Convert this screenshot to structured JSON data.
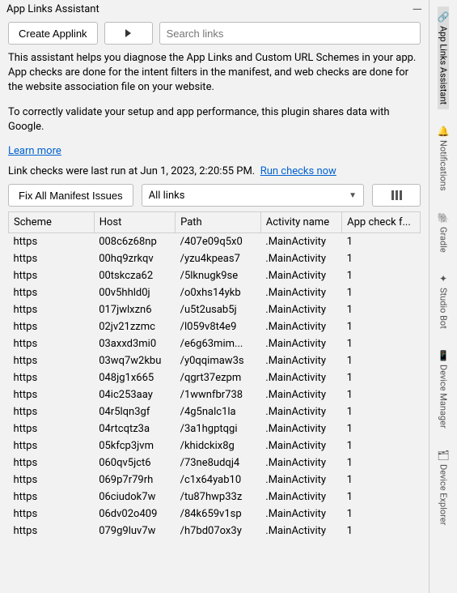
{
  "panel": {
    "title": "App Links Assistant"
  },
  "toolbar": {
    "create_label": "Create Applink"
  },
  "search": {
    "placeholder": "Search links"
  },
  "intro": {
    "p1": "This assistant helps you diagnose the App Links and Custom URL Schemes in your app. App checks are done for the intent filters in the manifest, and web checks are done for the website association file on your website.",
    "p2": "To correctly validate your setup and app performance, this plugin shares data with Google.",
    "learn_more": "Learn more"
  },
  "status": {
    "last_run_prefix": "Link checks were last run at ",
    "last_run_time": "Jun 1, 2023, 2:20:55 PM.",
    "run_now": "Run checks now"
  },
  "filters": {
    "fix_label": "Fix All Manifest Issues",
    "dropdown_label": "All links"
  },
  "table": {
    "headers": {
      "scheme": "Scheme",
      "host": "Host",
      "path": "Path",
      "activity": "Activity name",
      "appcheck": "App check f..."
    },
    "rows": [
      {
        "scheme": "https",
        "host": "008c6z68np",
        "path": "/407e09q5x0",
        "activity": ".MainActivity",
        "appcheck": "1"
      },
      {
        "scheme": "https",
        "host": "00hq9zrkqv",
        "path": "/yzu4kpeas7",
        "activity": ".MainActivity",
        "appcheck": "1"
      },
      {
        "scheme": "https",
        "host": "00tskcza62",
        "path": "/5lknugk9se",
        "activity": ".MainActivity",
        "appcheck": "1"
      },
      {
        "scheme": "https",
        "host": "00v5hhld0j",
        "path": "/o0xhs14ykb",
        "activity": ".MainActivity",
        "appcheck": "1"
      },
      {
        "scheme": "https",
        "host": "017jwlxzn6",
        "path": "/u5t2usab5j",
        "activity": ".MainActivity",
        "appcheck": "1"
      },
      {
        "scheme": "https",
        "host": "02jv21zzmc",
        "path": "/l059v8t4e9",
        "activity": ".MainActivity",
        "appcheck": "1"
      },
      {
        "scheme": "https",
        "host": "03axxd3mi0",
        "path": "/e6g63mim...",
        "activity": ".MainActivity",
        "appcheck": "1"
      },
      {
        "scheme": "https",
        "host": "03wq7w2kbu",
        "path": "/y0qqimaw3s",
        "activity": ".MainActivity",
        "appcheck": "1"
      },
      {
        "scheme": "https",
        "host": "048jg1x665",
        "path": "/qgrt37ezpm",
        "activity": ".MainActivity",
        "appcheck": "1"
      },
      {
        "scheme": "https",
        "host": "04ic253aay",
        "path": "/1wwnfbr738",
        "activity": ".MainActivity",
        "appcheck": "1"
      },
      {
        "scheme": "https",
        "host": "04r5lqn3gf",
        "path": "/4g5nalc1la",
        "activity": ".MainActivity",
        "appcheck": "1"
      },
      {
        "scheme": "https",
        "host": "04rtcqtz3a",
        "path": "/3a1hgptqgi",
        "activity": ".MainActivity",
        "appcheck": "1"
      },
      {
        "scheme": "https",
        "host": "05kfcp3jvm",
        "path": "/khidckix8g",
        "activity": ".MainActivity",
        "appcheck": "1"
      },
      {
        "scheme": "https",
        "host": "060qv5jct6",
        "path": "/73ne8udqj4",
        "activity": ".MainActivity",
        "appcheck": "1"
      },
      {
        "scheme": "https",
        "host": "069p7r79rh",
        "path": "/c1x64yab10",
        "activity": ".MainActivity",
        "appcheck": "1"
      },
      {
        "scheme": "https",
        "host": "06ciudok7w",
        "path": "/tu87hwp33z",
        "activity": ".MainActivity",
        "appcheck": "1"
      },
      {
        "scheme": "https",
        "host": "06dv02o409",
        "path": "/84k659v1sp",
        "activity": ".MainActivity",
        "appcheck": "1"
      },
      {
        "scheme": "https",
        "host": "079g9luv7w",
        "path": "/h7bd07ox3y",
        "activity": ".MainActivity",
        "appcheck": "1"
      }
    ]
  },
  "rail": {
    "items": [
      {
        "label": "App Links Assistant",
        "icon": "🔗"
      },
      {
        "label": "Notifications",
        "icon": "🔔"
      },
      {
        "label": "Gradle",
        "icon": "🐘"
      },
      {
        "label": "Studio Bot",
        "icon": "✦"
      },
      {
        "label": "Device Manager",
        "icon": "📱"
      },
      {
        "label": "Device Explorer",
        "icon": "🗂"
      }
    ]
  }
}
